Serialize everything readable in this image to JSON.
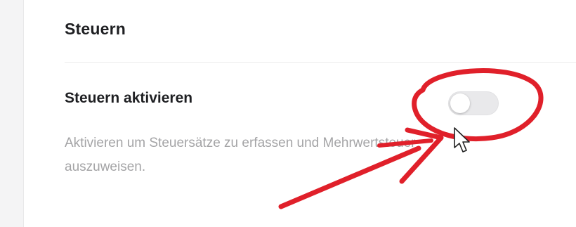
{
  "section": {
    "title": "Steuern"
  },
  "setting": {
    "label": "Steuern aktivieren",
    "description": "Aktivieren um Steuersätze zu erfassen und Mehrwertsteuer auszuweisen.",
    "toggle_enabled": false
  },
  "annotation": {
    "color": "#e0202a",
    "shapes": [
      "circle",
      "arrow"
    ]
  },
  "icons": {
    "cursor": "mouse-pointer-icon"
  }
}
